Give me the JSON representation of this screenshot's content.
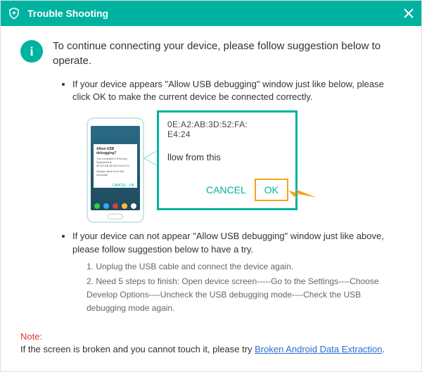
{
  "titlebar": {
    "title": "Trouble Shooting"
  },
  "heading": "To continue connecting your device, please follow suggestion below to operate.",
  "bullet1": "If your device appears \"Allow USB debugging\" window just like below, please click OK to make the current device  be connected correctly.",
  "popup": {
    "mac_line1": "0E:A2:AB:3D:52:FA:",
    "mac_line2": "E4:24",
    "allow_text": "llow from this",
    "cancel": "CANCEL",
    "ok": "OK"
  },
  "phone_popup": {
    "title": "Allow USB debugging?",
    "body1": "The computer's RSA key",
    "body2": "fingerprint is:",
    "body3": "0E:A2:AB:3D:52:FA:E4:24",
    "chk": "Always allow from this computer",
    "cancel": "CANCEL",
    "ok": "OK"
  },
  "bullet2": "If your device can not appear \"Allow USB debugging\" window just like above, please follow suggestion below to have a try.",
  "step1": "1. Unplug the USB cable and connect the device again.",
  "step2": "2. Need 5 steps to finish: Open device screen-----Go to the Settings----Choose Develop Options----Uncheck the USB debugging mode----Check the USB debugging mode again.",
  "note": {
    "label": "Note:",
    "text": "If the screen is broken and you cannot touch it, please try ",
    "link": "Broken Android Data Extraction",
    "after": "."
  }
}
